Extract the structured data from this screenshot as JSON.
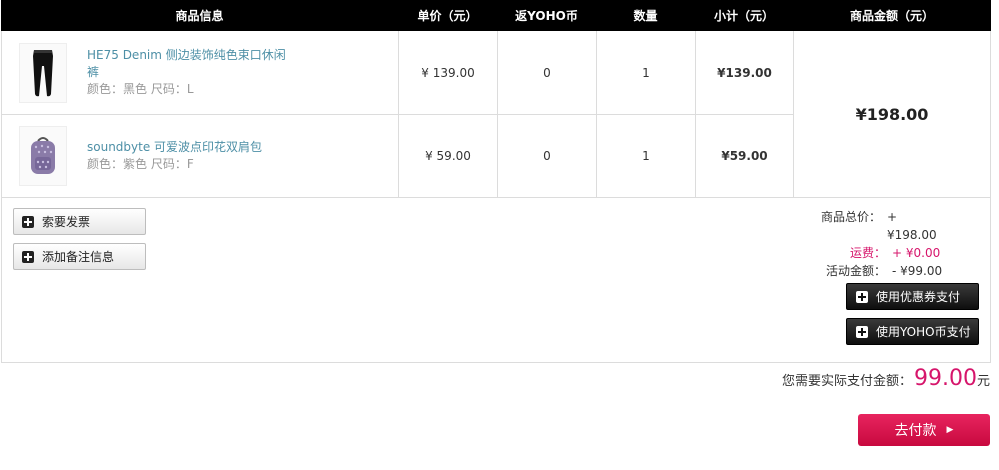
{
  "table": {
    "headers": {
      "info": "商品信息",
      "price": "单价（元）",
      "coin": "返YOHO币",
      "qty": "数量",
      "subtotal": "小计（元）",
      "total": "商品金额（元）"
    },
    "items": [
      {
        "name": "HE75 Denim 侧边装饰纯色束口休闲裤",
        "attrs": "颜色：黑色 尺码：L",
        "price": "¥ 139.00",
        "coin": "0",
        "qty": "1",
        "subtotal": "¥139.00",
        "image_icon": "black-pants-icon"
      },
      {
        "name": "soundbyte 可爱波点印花双肩包",
        "attrs": "颜色：紫色 尺码：F",
        "price": "¥ 59.00",
        "coin": "0",
        "qty": "1",
        "subtotal": "¥59.00",
        "image_icon": "purple-backpack-icon"
      }
    ],
    "grand_total": "¥198.00"
  },
  "actions": {
    "invoice_label": "索要发票",
    "note_label": "添加备注信息",
    "coupon_label": "使用优惠券支付",
    "yoho_coin_label": "使用YOHO币支付"
  },
  "fees": {
    "goods_total_label": "商品总价：",
    "goods_total_value": "+ ¥198.00",
    "shipping_label": "运费：",
    "shipping_value": "+ ¥0.00",
    "promo_label": "活动金额：",
    "promo_value": "- ¥99.00"
  },
  "payment": {
    "label": "您需要实际支付金额：",
    "amount": "99.00",
    "unit": "元",
    "button_label": "去付款"
  },
  "colors": {
    "accent": "#d6156b",
    "header_bg": "#000000",
    "link": "#4d8fa6"
  }
}
